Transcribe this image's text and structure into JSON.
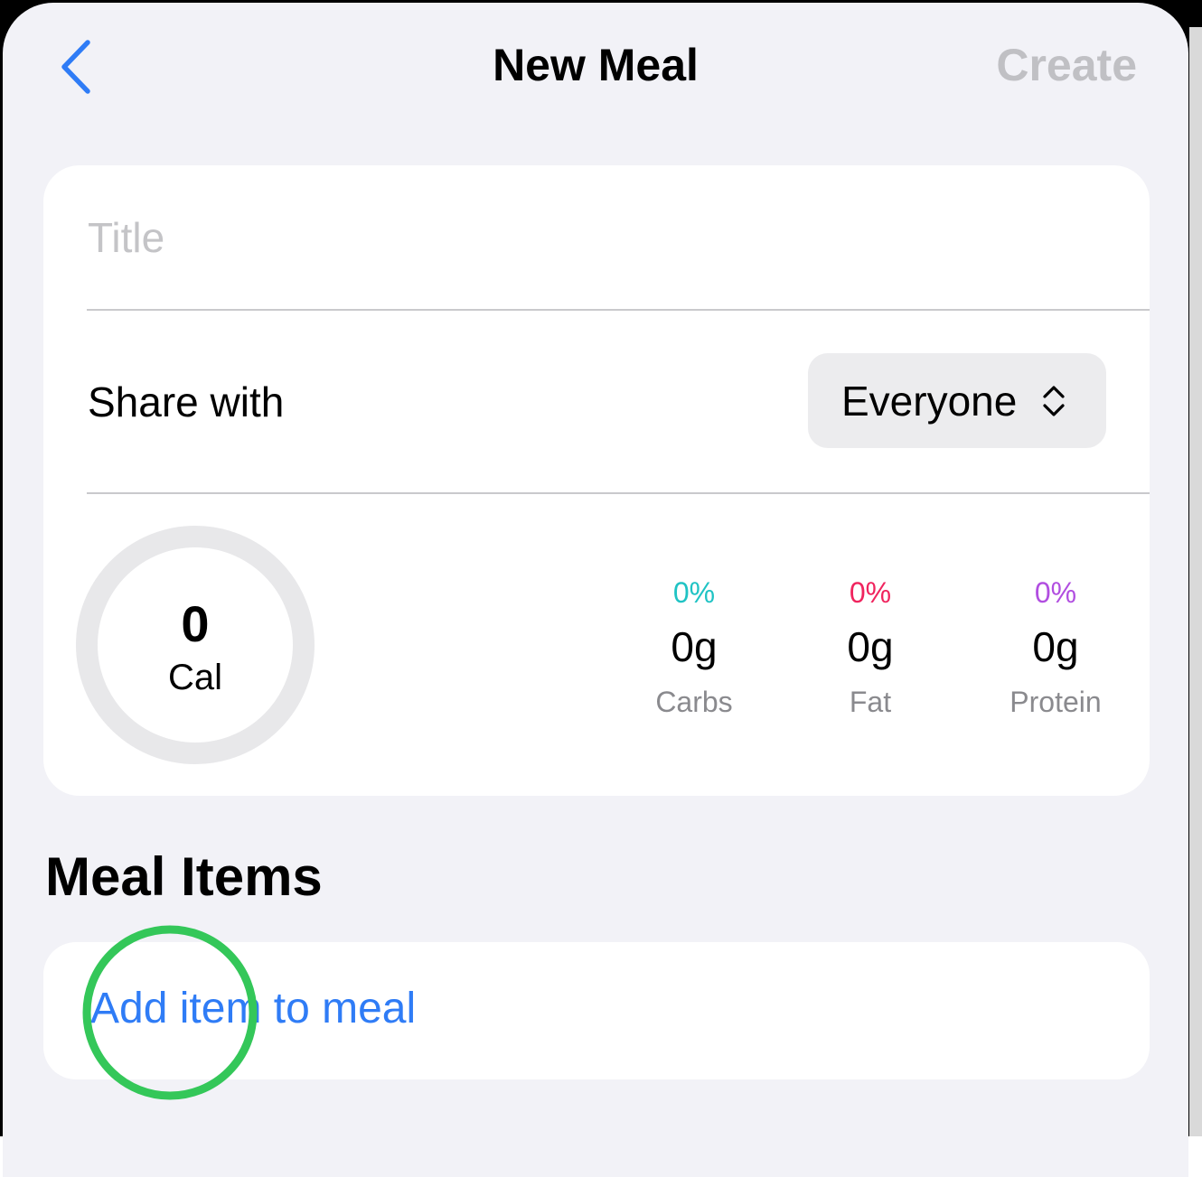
{
  "nav": {
    "back_icon": "chevron-left-icon",
    "title": "New Meal",
    "create_label": "Create"
  },
  "form": {
    "title_placeholder": "Title",
    "title_value": "",
    "share_label": "Share with",
    "share_value": "Everyone",
    "share_icon": "up-down-chevron-icon"
  },
  "summary": {
    "calories_value": "0",
    "calories_unit": "Cal",
    "macros": [
      {
        "percent": "0%",
        "grams": "0g",
        "label": "Carbs",
        "color": "#1fc3c4"
      },
      {
        "percent": "0%",
        "grams": "0g",
        "label": "Fat",
        "color": "#f0245e"
      },
      {
        "percent": "0%",
        "grams": "0g",
        "label": "Protein",
        "color": "#b14ee0"
      }
    ]
  },
  "meal_items": {
    "heading": "Meal Items",
    "add_label": "Add item to meal"
  },
  "colors": {
    "accent": "#2f7cf6",
    "tap_indicator": "#34c759",
    "background": "#f2f2f7"
  }
}
